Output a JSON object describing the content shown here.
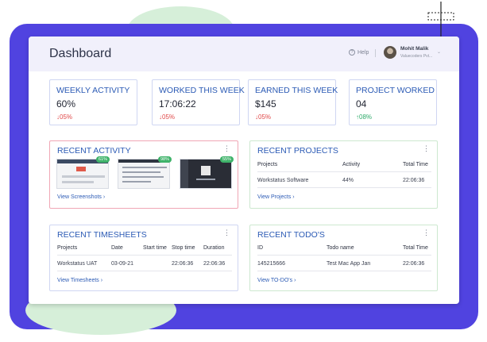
{
  "header": {
    "title": "Dashboard",
    "help_label": "Help",
    "user_name": "Mohit Malik",
    "user_company": "Valuecoders Pvt..."
  },
  "stats": [
    {
      "label": "WEEKLY ACTIVITY",
      "value": "60%",
      "delta": "05%",
      "direction": "down"
    },
    {
      "label": "WORKED THIS WEEK",
      "value": "17:06:22",
      "delta": "05%",
      "direction": "down"
    },
    {
      "label": "EARNED THIS WEEK",
      "value": "$145",
      "delta": "05%",
      "direction": "down"
    },
    {
      "label": "PROJECT WORKED",
      "value": "04",
      "delta": "08%",
      "direction": "up"
    }
  ],
  "recent_activity": {
    "title": "RECENT ACTIVITY",
    "screenshots": [
      {
        "percent": "61%"
      },
      {
        "percent": "98%"
      },
      {
        "percent": "55%"
      }
    ],
    "link": "View Screenshots"
  },
  "recent_projects": {
    "title": "RECENT PROJECTS",
    "columns": [
      "Projects",
      "Activity",
      "Total Time"
    ],
    "rows": [
      [
        "Workstatus Software",
        "44%",
        "22:06:36"
      ]
    ],
    "link": "View Projects"
  },
  "recent_timesheets": {
    "title": "RECENT TIMESHEETS",
    "columns": [
      "Projects",
      "Date",
      "Start time",
      "Stop time",
      "Duration"
    ],
    "rows": [
      [
        "Workstatus UAT",
        "03-09-21",
        "",
        "22:06:36",
        "22:06:36"
      ]
    ],
    "link": "View Timesheets"
  },
  "recent_todos": {
    "title": "RECENT TODO'S",
    "columns": [
      "ID",
      "Todo name",
      "Total Time"
    ],
    "rows": [
      [
        "145215666",
        "Test Mac App Jan",
        "22:06:36"
      ]
    ],
    "link": "View TO-DO's"
  },
  "colors": {
    "accent": "#2c5bb5",
    "down": "#e04848",
    "up": "#2faa6a",
    "backdrop": "#5043e0",
    "activity_border": "#f0a6b5"
  }
}
